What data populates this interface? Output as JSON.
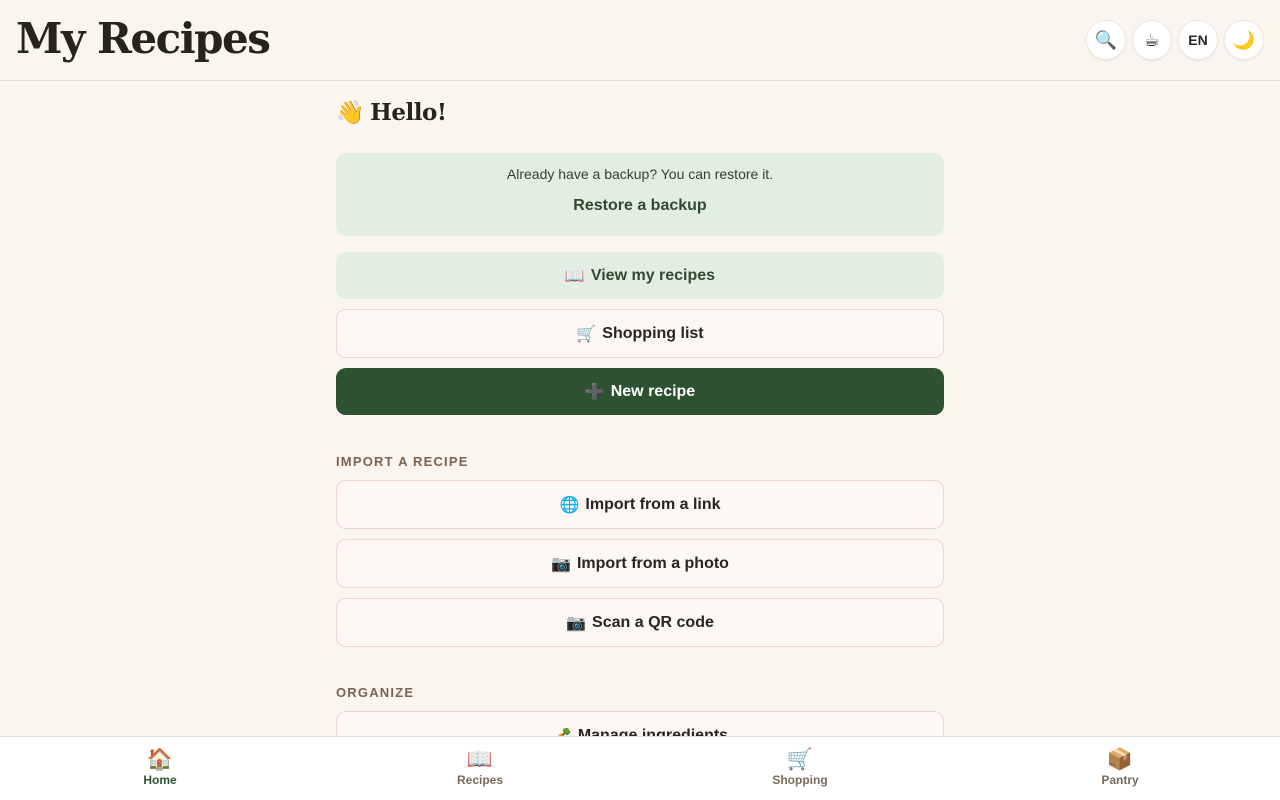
{
  "header": {
    "title": "My Recipes",
    "actions": [
      {
        "icon": "search-icon",
        "glyph": "🔍"
      },
      {
        "icon": "coffee-icon",
        "glyph": "☕"
      },
      {
        "icon": "language-toggle",
        "glyph": "EN"
      },
      {
        "icon": "moon-icon",
        "glyph": "🌙"
      }
    ]
  },
  "main": {
    "greeting": {
      "icon": "👋",
      "text": "Hello!"
    },
    "restore": {
      "text": "Already have a backup? You can restore it.",
      "link": "Restore a backup"
    },
    "view_recipes": {
      "icon": "📖",
      "label": "View my recipes"
    },
    "shopping_list": {
      "icon": "🛒",
      "label": "Shopping list"
    },
    "new_recipe": {
      "icon": "➕",
      "label": "New recipe"
    },
    "import_section": {
      "label": "IMPORT A RECIPE",
      "items": [
        {
          "icon": "🌐",
          "label": "Import from a link"
        },
        {
          "icon": "📷",
          "label": "Import from a photo"
        },
        {
          "icon": "📷",
          "label": "Scan a QR code"
        }
      ]
    },
    "organize_section": {
      "label": "ORGANIZE",
      "items": [
        {
          "icon": "🥕",
          "label": "Manage ingredients"
        }
      ]
    }
  },
  "bottom_nav": {
    "active": "Home",
    "items": [
      {
        "icon": "🏠",
        "label": "Home"
      },
      {
        "icon": "📖",
        "label": "Recipes"
      },
      {
        "icon": "🛒",
        "label": "Shopping"
      },
      {
        "icon": "📦",
        "label": "Pantry"
      }
    ]
  },
  "colors": {
    "background": "#faf5ef",
    "accent_green": "#2e5131",
    "soft_green": "#e3eee3",
    "outline": "#edd6cb"
  }
}
